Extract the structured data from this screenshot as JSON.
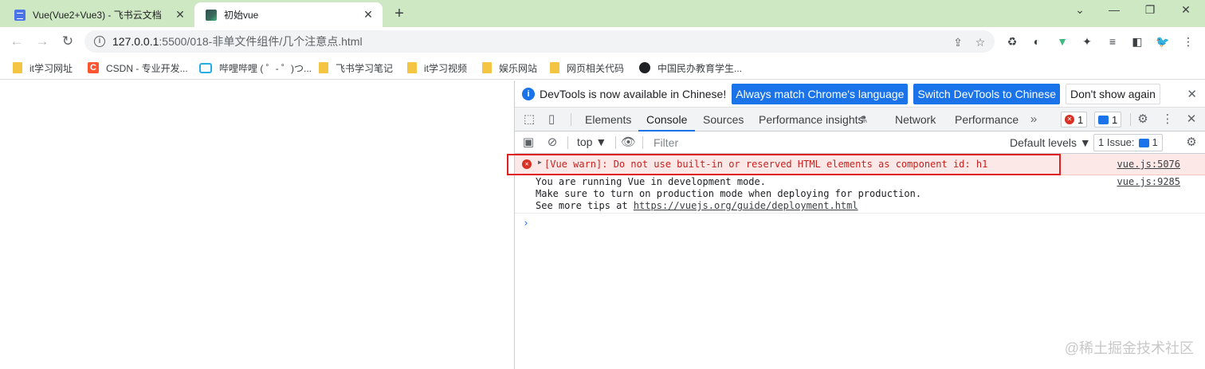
{
  "tabs": [
    {
      "title": "Vue(Vue2+Vue3) - 飞书云文档",
      "close": "✕"
    },
    {
      "title": "初始vue",
      "close": "✕"
    }
  ],
  "new_tab": "+",
  "window_controls": {
    "minimize": "⌄",
    "restore": "❐",
    "close": "✕"
  },
  "toolbar": {
    "back": "←",
    "forward": "→",
    "reload": "↻",
    "url_host": "127.0.0.1",
    "url_path": ":5500/018-非单文件组件/几个注意点.html",
    "info": "i",
    "share": "⇪",
    "star": "☆",
    "extensions": [
      "♻",
      "◐",
      "▼",
      "✦",
      "≡",
      "◧",
      "🐦",
      "⋮"
    ]
  },
  "bookmarks": [
    {
      "label": "it学习网址",
      "icon": "folder"
    },
    {
      "label": "CSDN - 专业开发...",
      "icon": "csdn-logo",
      "glyph": "C"
    },
    {
      "label": "哔哩哔哩 ( ゜- ゜)つ...",
      "icon": "bilibili-logo"
    },
    {
      "label": "飞书学习笔记",
      "icon": "folder"
    },
    {
      "label": "it学习视频",
      "icon": "folder"
    },
    {
      "label": "娱乐网站",
      "icon": "folder"
    },
    {
      "label": "网页相关代码",
      "icon": "folder"
    },
    {
      "label": "中国民办教育学生...",
      "icon": "globe"
    }
  ],
  "devtools": {
    "infobar": {
      "icon": "i",
      "message": "DevTools is now available in Chinese!",
      "btn_match": "Always match Chrome's language",
      "btn_switch": "Switch DevTools to Chinese",
      "btn_dismiss": "Don't show again",
      "close": "✕"
    },
    "tabs": [
      "Elements",
      "Console",
      "Sources",
      "Performance insights",
      "Network",
      "Performance"
    ],
    "more_tabs": "»",
    "error_count": "1",
    "message_count": "1",
    "error_glyph": "✕",
    "settings": "⚙",
    "menu": "⋮",
    "close": "✕",
    "console_bar": {
      "context": "top ▼",
      "filter_placeholder": "Filter",
      "levels": "Default levels ▼",
      "issues": "1 Issue:",
      "issue_count": "1",
      "settings": "⚙"
    },
    "messages": {
      "error": {
        "icon": "✕",
        "arrow": "▶",
        "text": "[Vue warn]: Do not use built-in or reserved HTML elements as component id: h1",
        "source": "vue.js:5076"
      },
      "log": {
        "lines": [
          "You are running Vue in development mode.",
          "Make sure to turn on production mode when deploying for production.",
          "See more tips at "
        ],
        "link": "https://vuejs.org/guide/deployment.html",
        "source": "vue.js:9285"
      },
      "prompt": "›"
    }
  },
  "watermark": "@稀土掘金技术社区",
  "colors": {
    "accent": "#1a73e8",
    "error": "#d93025",
    "tabstrip": "#cfe8c4",
    "highlight_box": "#e02020"
  }
}
